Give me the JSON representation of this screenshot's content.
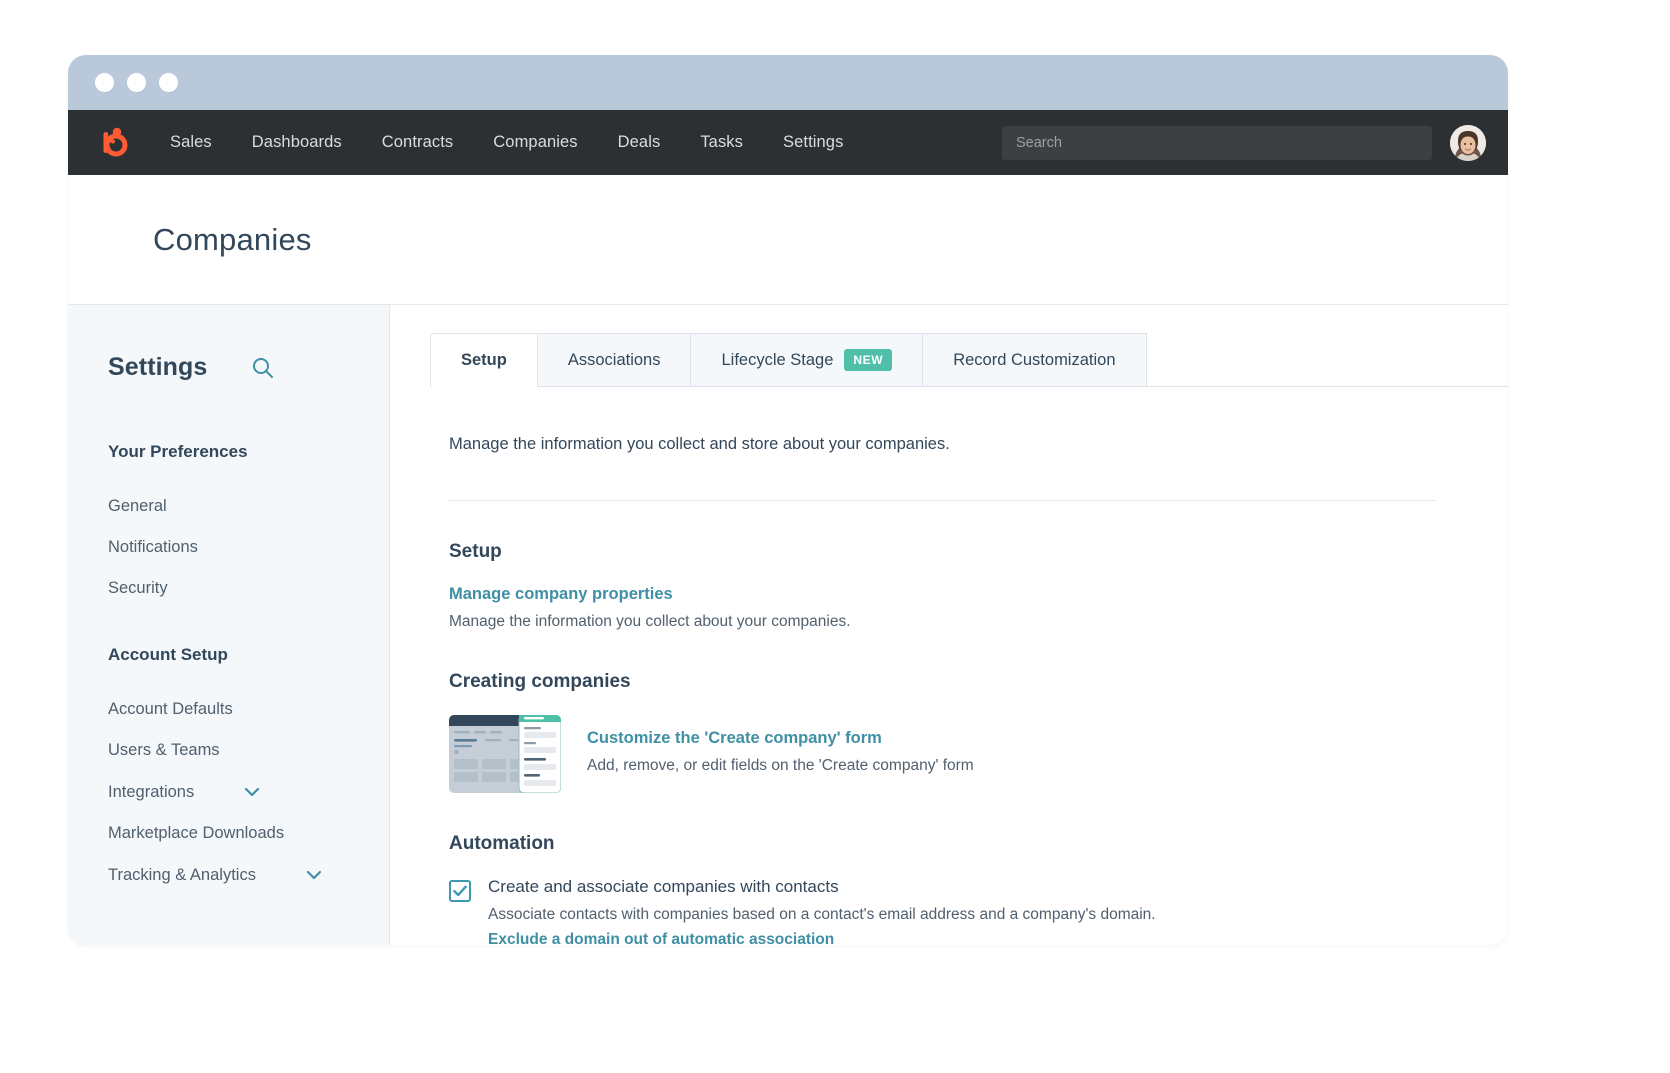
{
  "window": {
    "chrome_color": "#b9c9da",
    "dots": [
      "close",
      "minimize",
      "maximize"
    ]
  },
  "navbar": {
    "logo": "hubspot-logo",
    "links": [
      {
        "label": "Sales"
      },
      {
        "label": "Dashboards"
      },
      {
        "label": "Contracts"
      },
      {
        "label": "Companies"
      },
      {
        "label": "Deals"
      },
      {
        "label": "Tasks"
      },
      {
        "label": "Settings"
      }
    ],
    "search": {
      "value": "",
      "placeholder": "Search"
    },
    "avatar": "user-avatar",
    "background": "#2d3032"
  },
  "header": {
    "title": "Companies"
  },
  "sidebar": {
    "title": "Settings",
    "search_icon": "search-icon",
    "groups": [
      {
        "label": "Your Preferences",
        "items": [
          {
            "label": "General",
            "expandable": false
          },
          {
            "label": "Notifications",
            "expandable": false
          },
          {
            "label": "Security",
            "expandable": false
          }
        ]
      },
      {
        "label": "Account Setup",
        "items": [
          {
            "label": "Account Defaults",
            "expandable": false
          },
          {
            "label": "Users & Teams",
            "expandable": false
          },
          {
            "label": "Integrations",
            "expandable": true
          },
          {
            "label": "Marketplace Downloads",
            "expandable": false
          },
          {
            "label": "Tracking & Analytics",
            "expandable": true
          }
        ]
      }
    ]
  },
  "main": {
    "tabs": [
      {
        "label": "Setup",
        "active": true,
        "badge": ""
      },
      {
        "label": "Associations",
        "active": false,
        "badge": ""
      },
      {
        "label": "Lifecycle Stage",
        "active": false,
        "badge": "NEW"
      },
      {
        "label": "Record Customization",
        "active": false,
        "badge": ""
      }
    ],
    "intro": "Manage the information you collect and store about your companies.",
    "sections": {
      "setup": {
        "title": "Setup",
        "link": "Manage company properties",
        "description": "Manage the information you collect about your companies."
      },
      "creating_companies": {
        "title": "Creating companies",
        "thumbnail": "create-company-form-preview",
        "link": "Customize the 'Create company' form",
        "description": "Add, remove, or edit fields on the 'Create company' form"
      },
      "automation": {
        "title": "Automation",
        "checkbox_checked": true,
        "checkbox_label": "Create and associate companies with contacts",
        "description": "Associate contacts with companies based on a contact's email address and a company's domain.",
        "link": "Exclude a domain out of automatic association"
      }
    }
  },
  "colors": {
    "accent_link": "#3f8fa5",
    "badge_new": "#4fbfa8",
    "text_primary": "#33475b",
    "text_secondary": "#51606e",
    "sidebar_bg": "#f5f8fa",
    "nav_bg": "#2d3032",
    "logo_orange": "#ff5c35"
  }
}
